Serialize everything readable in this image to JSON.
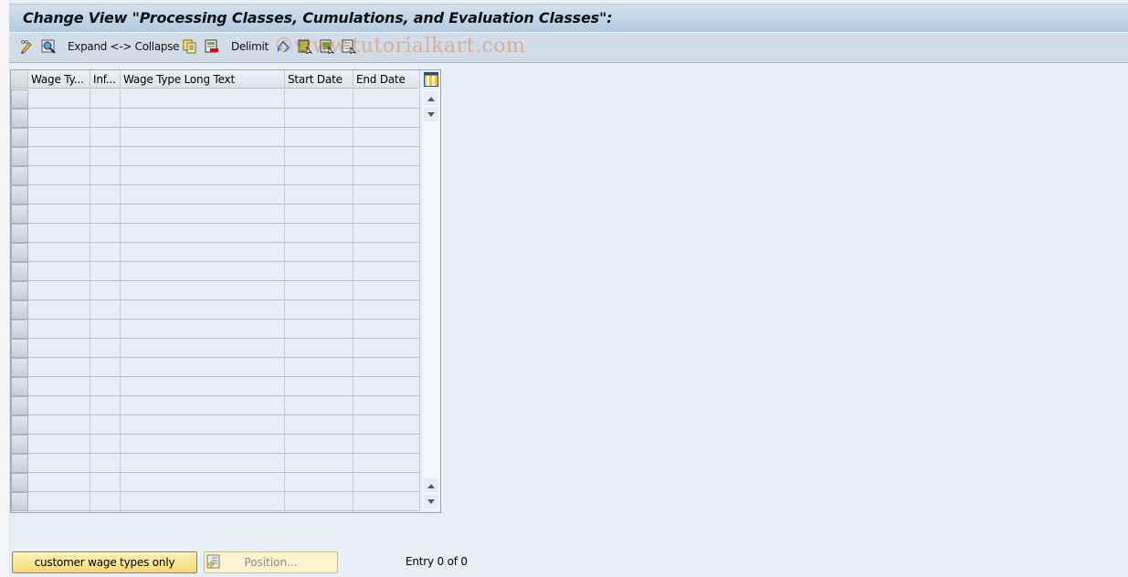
{
  "title": "Change View \"Processing Classes, Cumulations, and Evaluation Classes\":",
  "toolbar": {
    "items": [
      {
        "icon": "display-change-icon",
        "label": ""
      },
      {
        "icon": "details-icon",
        "label": ""
      },
      {
        "icon": "",
        "label": "Expand <-> Collapse"
      },
      {
        "icon": "copy-icon",
        "label": ""
      },
      {
        "icon": "delete-icon",
        "label": ""
      },
      {
        "icon": "",
        "label": "Delimit"
      },
      {
        "icon": "undo-change-icon",
        "label": ""
      },
      {
        "icon": "select-all-icon",
        "label": ""
      },
      {
        "icon": "select-block-icon",
        "label": ""
      },
      {
        "icon": "deselect-all-icon",
        "label": ""
      }
    ]
  },
  "watermark": "©www.tutorialkart.com",
  "table": {
    "columns": [
      {
        "label": "Wage Ty..."
      },
      {
        "label": "Inf..."
      },
      {
        "label": "Wage Type Long Text"
      },
      {
        "label": "Start Date"
      },
      {
        "label": "End Date"
      }
    ],
    "rows": [
      [],
      [],
      [],
      [],
      [],
      [],
      [],
      [],
      [],
      [],
      [],
      [],
      [],
      [],
      [],
      [],
      [],
      [],
      [],
      [],
      [],
      []
    ]
  },
  "footer": {
    "customer_button": "customer wage types only",
    "position_button": "Position...",
    "entry_text": "Entry 0 of 0"
  },
  "colors": {
    "background": "#e9eff7",
    "title_gradient_top": "#d3e1ee",
    "title_gradient_bottom": "#b2c9df",
    "toolbar": "#d0dce8",
    "button_yellow": "#f7d978"
  }
}
